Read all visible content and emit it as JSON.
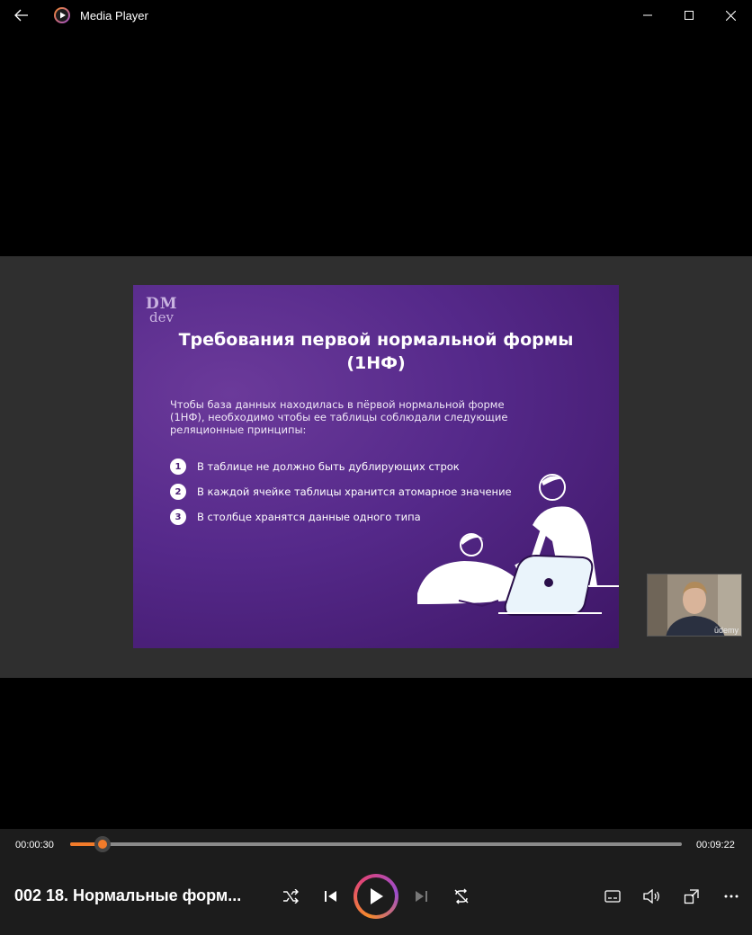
{
  "window": {
    "title": "Media Player",
    "icons": [
      "back-arrow-icon",
      "media-player-app-icon",
      "minimize-icon",
      "maximize-icon",
      "close-icon"
    ]
  },
  "slide": {
    "logo_line1": "DM",
    "logo_line2": "dev",
    "title": "Требования первой нормальной формы (1НФ)",
    "intro": "Чтобы база данных находилась в пёрвой нормальной форме (1НФ), необходимо чтобы ее таблицы соблюдали следующие реляционные принципы:",
    "items": [
      {
        "num": "1",
        "text": "В таблице не должно быть дублирующих строк"
      },
      {
        "num": "2",
        "text": "В каждой ячейке таблицы хранится атомарное значение"
      },
      {
        "num": "3",
        "text": "В столбце хранятся данные одного типа"
      }
    ],
    "colors": {
      "background": "#55298a",
      "accent": "#ffffff"
    }
  },
  "webcam": {
    "watermark": "ūdemy"
  },
  "player": {
    "current_time": "00:00:30",
    "total_time": "00:09:22",
    "progress_fraction": 0.053,
    "media_title": "002 18. Нормальные форм...",
    "accent_color": "#f27b2a",
    "controls": [
      "shuffle-icon",
      "previous-icon",
      "play-icon",
      "next-icon",
      "repeat-off-icon",
      "subtitles-icon",
      "volume-icon",
      "mini-player-icon",
      "more-options-icon"
    ]
  }
}
